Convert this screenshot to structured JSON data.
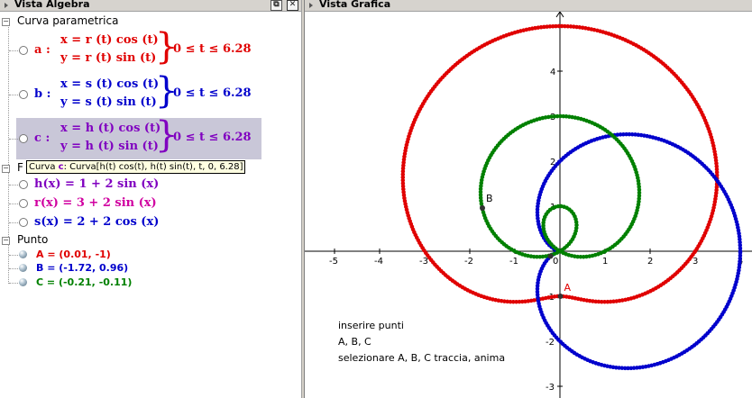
{
  "algebra": {
    "title": "Vista Algebra",
    "groups": {
      "curves": "Curva parametrica",
      "functions": "F",
      "points": "Punto"
    },
    "curves": [
      {
        "name": "a :",
        "x": "x = r (t)  cos (t)",
        "y": "y = r (t)  sin (t)",
        "range": "0 ≤ t ≤ 6.28",
        "color": "#e00000"
      },
      {
        "name": "b :",
        "x": "x = s (t)  cos (t)",
        "y": "y = s (t)  sin (t)",
        "range": "0 ≤ t ≤ 6.28",
        "color": "#0000cc"
      },
      {
        "name": "c :",
        "x": "x = h (t)  cos (t)",
        "y": "y = h (t)  sin (t)",
        "range": "0 ≤ t ≤ 6.28",
        "color": "#8000c0"
      }
    ],
    "tooltip": {
      "prefix": "Curva ",
      "name": "c",
      "rest": ": Curva[h(t) cos(t), h(t) sin(t), t, 0, 6.28]"
    },
    "functions": [
      {
        "text": "h(x) = 1 + 2  sin (x)",
        "color": "#8000c0"
      },
      {
        "text": "r(x) = 3 + 2  sin (x)",
        "color": "#d000a0"
      },
      {
        "text": "s(x) = 2 + 2  cos (x)",
        "color": "#0000cc"
      }
    ],
    "points": [
      {
        "text": "A = (0.01, -1)",
        "color": "#e00000"
      },
      {
        "text": "B = (-1.72, 0.96)",
        "color": "#0000cc"
      },
      {
        "text": "C = (-0.21, -0.11)",
        "color": "#008000"
      }
    ]
  },
  "graphics": {
    "title": "Vista Grafica",
    "x_ticks": [
      "-5",
      "-4",
      "-3",
      "-2",
      "-1",
      "0",
      "1",
      "2",
      "3",
      "4"
    ],
    "y_ticks": [
      "4",
      "3",
      "2",
      "1",
      "-1",
      "-2",
      "-3"
    ],
    "point_labels": {
      "A": "A",
      "B": "B"
    },
    "note_lines": [
      "inserire punti",
      "A, B, C",
      "selezionare A, B, C traccia, anima"
    ]
  }
}
